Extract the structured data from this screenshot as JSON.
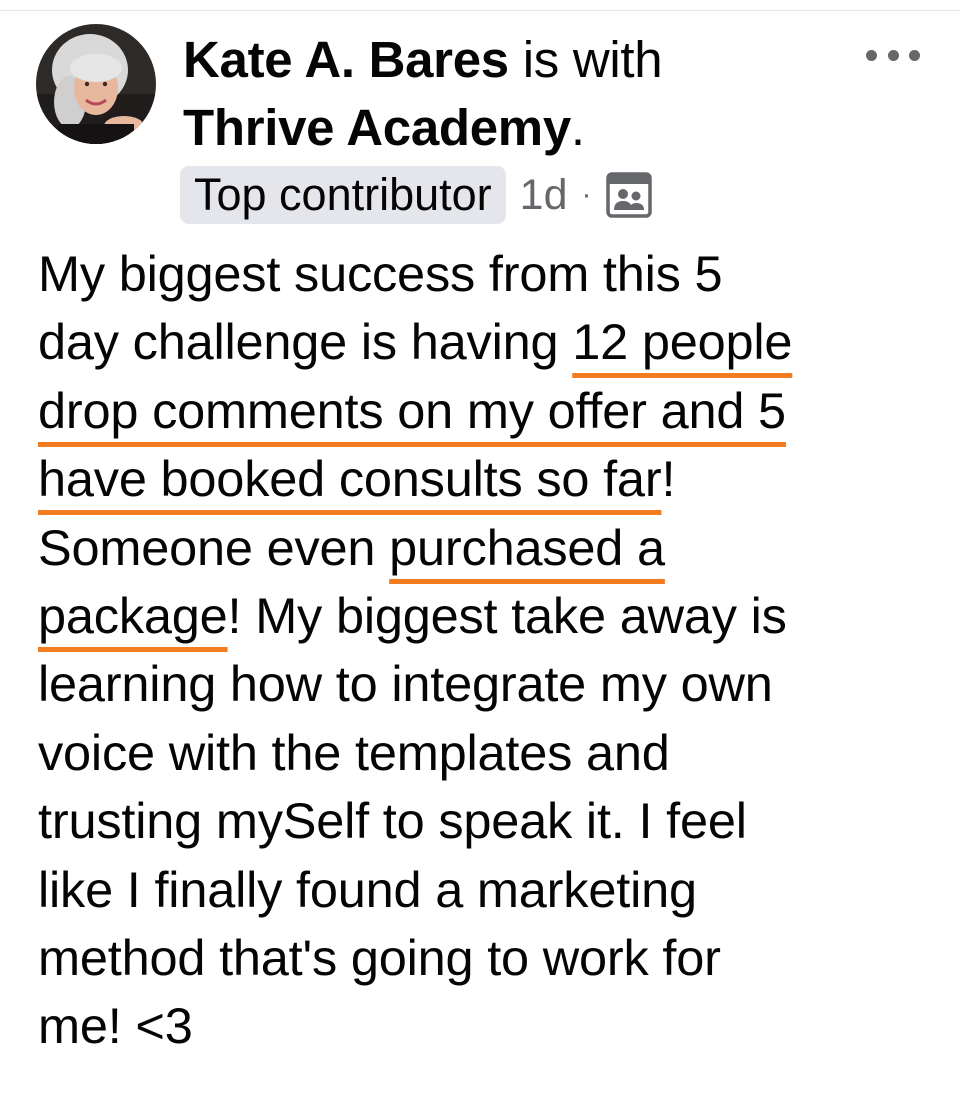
{
  "post": {
    "author": "Kate A. Bares",
    "with_text": " is with",
    "group": "Thrive Academy",
    "group_suffix": ".",
    "badge": "Top contributor",
    "time": "1d",
    "separator": "·",
    "avatar_icon": "user-avatar-photo",
    "audience_icon": "group-audience-icon",
    "more_icon": "more-options-icon",
    "highlight_color": "#f47c20",
    "text_lines": [
      [
        {
          "t": "My biggest success from this 5"
        }
      ],
      [
        {
          "t": "day challenge is having "
        },
        {
          "t": "12 people",
          "u": true
        }
      ],
      [
        {
          "t": "drop comments on my offer and 5",
          "u": true
        }
      ],
      [
        {
          "t": "have booked consults so far",
          "u": true
        },
        {
          "t": "!"
        }
      ],
      [
        {
          "t": "Someone even "
        },
        {
          "t": "purchased a",
          "u": true
        }
      ],
      [
        {
          "t": "package",
          "u": true
        },
        {
          "t": "! My biggest take away is"
        }
      ],
      [
        {
          "t": "learning how to integrate my own"
        }
      ],
      [
        {
          "t": "voice with the templates and"
        }
      ],
      [
        {
          "t": "trusting mySelf to speak it. I feel"
        }
      ],
      [
        {
          "t": "like I finally found a marketing"
        }
      ],
      [
        {
          "t": "method that's going to work for"
        }
      ],
      [
        {
          "t": "me! <3"
        }
      ]
    ]
  }
}
